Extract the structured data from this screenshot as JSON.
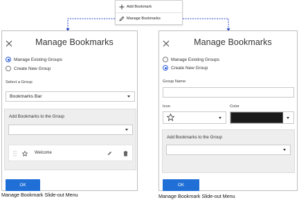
{
  "menu": {
    "items": [
      {
        "label": "Add Bookmark",
        "icon": "plus-icon"
      },
      {
        "label": "Manage Bookmarks",
        "icon": "pencil-icon"
      }
    ]
  },
  "connector_color": "#1f3fbf",
  "left_panel": {
    "title": "Manage Bookmarks",
    "radio_manage": "Manage Existing Groups",
    "radio_create": "Create New Group",
    "selected_radio": "manage",
    "select_group_label": "Select a Group",
    "select_group_value": "Bookmarks Bar",
    "add_bookmarks_label": "Add Bookmarks to the Group",
    "bookmarks": [
      {
        "name": "Welcome"
      }
    ],
    "ok_label": "OK",
    "caption": "Manage Bookmark Slide-out Menu"
  },
  "right_panel": {
    "title": "Manage Bookmarks",
    "radio_manage": "Manage Existing Groups",
    "radio_create": "Create New Group",
    "selected_radio": "create",
    "group_name_label": "Group Name",
    "icon_label": "Icon",
    "color_label": "Color",
    "color_value": "#1a1a1a",
    "add_bookmarks_label": "Add Bookmarks to the Group",
    "ok_label": "OK",
    "caption": "Manage Bookmark Slide-out Menu"
  },
  "accent_color": "#1f6fd6"
}
